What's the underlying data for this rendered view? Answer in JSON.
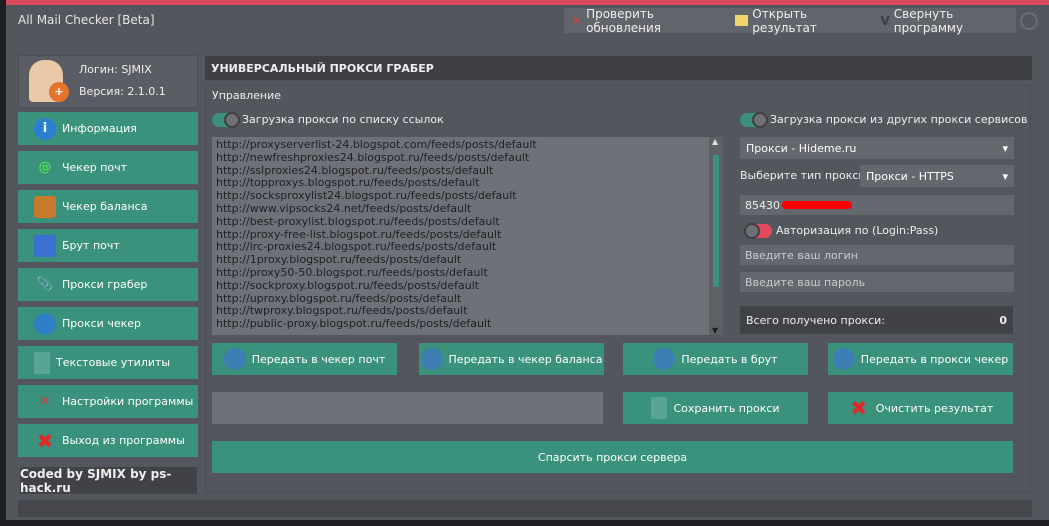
{
  "window": {
    "title": "All Mail Checker [Beta]"
  },
  "topbar": {
    "check_updates": "Проверить обновления",
    "open_result": "Открыть результат",
    "minimize": "Свернуть программу"
  },
  "profile": {
    "login": "Логин: SJMIX",
    "version": "Версия: 2.1.0.1"
  },
  "sidebar": {
    "items": [
      {
        "label": "Информация"
      },
      {
        "label": "Чекер почт"
      },
      {
        "label": "Чекер баланса"
      },
      {
        "label": "Брут почт"
      },
      {
        "label": "Прокси грабер"
      },
      {
        "label": "Прокси чекер"
      },
      {
        "label": "Текстовые утилиты"
      },
      {
        "label": "Настройки программы"
      },
      {
        "label": "Выход из программы"
      }
    ],
    "footer": "Coded by SJMIX by ps-hack.ru"
  },
  "main": {
    "title": "УНИВЕРСАЛЬНЫЙ ПРОКСИ ГРАБЕР",
    "group": "Управление",
    "toggle_links": "Загрузка прокси по списку ссылок",
    "toggle_services": "Загрузка прокси из других прокси сервисов",
    "links": [
      "http://proxyserverlist-24.blogspot.com/feeds/posts/default",
      "http://newfreshproxies24.blogspot.ru/feeds/posts/default",
      "http://sslproxies24.blogspot.ru/feeds/posts/default",
      "http://topproxys.blogspot.ru/feeds/posts/default",
      "http://socksproxylist24.blogspot.ru/feeds/posts/default",
      "http://www.vipsocks24.net/feeds/posts/default",
      "http://best-proxylist.blogspot.ru/feeds/posts/default",
      "http://proxy-free-list.blogspot.ru/feeds/posts/default",
      "http://irc-proxies24.blogspot.ru/feeds/posts/default",
      "http://1proxy.blogspot.ru/feeds/posts/default",
      "http://proxy50-50.blogspot.ru/feeds/posts/default",
      "http://sockproxy.blogspot.ru/feeds/posts/default",
      "http://uproxy.blogspot.ru/feeds/posts/default",
      "http://twproxy.blogspot.ru/feeds/posts/default",
      "http://public-proxy.blogspot.ru/feeds/posts/default"
    ],
    "service_select": "Прокси - Hideme.ru",
    "type_label": "Выберите тип прокси:",
    "type_select": "Прокси - HTTPS",
    "key_value": "85430",
    "auth_toggle": "Авторизация по (Login:Pass)",
    "login_placeholder": "Введите ваш логин",
    "password_placeholder": "Введите ваш пароль",
    "total_label": "Всего получено прокси:",
    "total_value": "0",
    "buttons": {
      "to_mail": "Передать в чекер почт",
      "to_balance": "Передать в чекер баланса",
      "to_brute": "Передать в брут",
      "to_proxy": "Передать в прокси чекер",
      "save": "Сохранить прокси",
      "clear": "Очистить результат",
      "parse": "Спарсить прокси сервера"
    }
  },
  "colors": {
    "accent": "#3a917c",
    "titlebar_border": "#d9485c"
  }
}
